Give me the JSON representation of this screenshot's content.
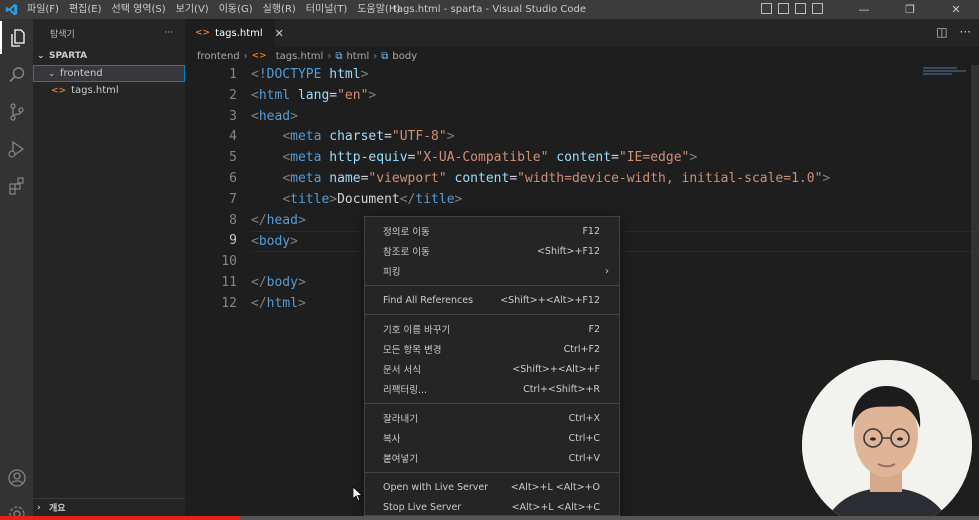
{
  "window": {
    "title": "tags.html - sparta - Visual Studio Code",
    "menu": [
      "파일(F)",
      "편집(E)",
      "선택 영역(S)",
      "보기(V)",
      "이동(G)",
      "실행(R)",
      "터미널(T)",
      "도움말(H)"
    ],
    "minimize": "—",
    "restore": "❐",
    "close": "✕"
  },
  "sidebar": {
    "header": "탐색기",
    "more": "···",
    "section": "SPARTA",
    "folder": "frontend",
    "file": "tags.html",
    "outline": "개요"
  },
  "editor": {
    "tab_label": "tags.html",
    "tab_close": "✕",
    "breadcrumb": {
      "folder": "frontend",
      "file": "tags.html",
      "html": "html",
      "body": "body"
    },
    "line_numbers": [
      "1",
      "2",
      "3",
      "4",
      "5",
      "6",
      "7",
      "8",
      "9",
      "10",
      "11",
      "12"
    ],
    "current_line": 9
  },
  "context_menu": {
    "items": [
      {
        "label": "정의로 이동",
        "shortcut": "F12"
      },
      {
        "label": "참조로 이동",
        "shortcut": "<Shift>+F12"
      },
      {
        "label": "피킹",
        "shortcut": "›"
      },
      {
        "label": "Find All References",
        "shortcut": "<Shift>+<Alt>+F12"
      },
      {
        "label": "기호 이름 바꾸기",
        "shortcut": "F2"
      },
      {
        "label": "모든 항목 변경",
        "shortcut": "Ctrl+F2"
      },
      {
        "label": "문서 서식",
        "shortcut": "<Shift>+<Alt>+F"
      },
      {
        "label": "리팩터링...",
        "shortcut": "Ctrl+<Shift>+R"
      },
      {
        "label": "잘라내기",
        "shortcut": "Ctrl+X"
      },
      {
        "label": "복사",
        "shortcut": "Ctrl+C"
      },
      {
        "label": "붙여넣기",
        "shortcut": "Ctrl+V"
      },
      {
        "label": "Open with Live Server",
        "shortcut": "<Alt>+L <Alt>+O"
      },
      {
        "label": "Stop Live Server",
        "shortcut": "<Alt>+L <Alt>+C"
      }
    ]
  },
  "video": {
    "progress_fraction": 0.245
  },
  "colors": {
    "accent": "#007acc",
    "tag": "#569cd6",
    "attribute": "#9cdcfe",
    "string": "#ce9178",
    "progress": "#e62117"
  }
}
